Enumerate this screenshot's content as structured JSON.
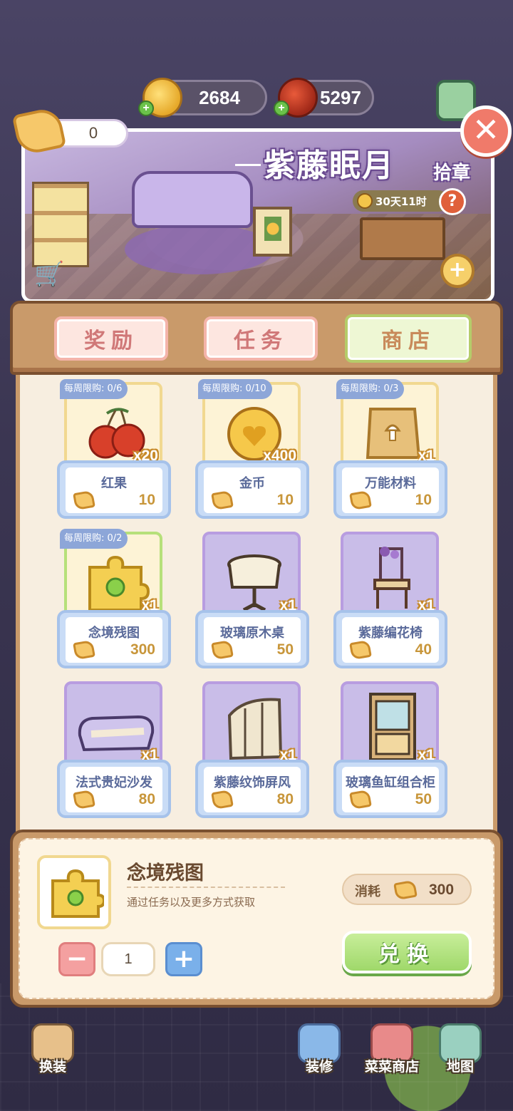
{
  "currencies": {
    "coins": "2684",
    "red_fruit": "5297"
  },
  "star_balance": "0",
  "event": {
    "title": "紫藤眠月",
    "chapter": "拾章",
    "timer": "30天11时",
    "help": "?"
  },
  "tabs": [
    {
      "label": "奖励",
      "active": false
    },
    {
      "label": "任务",
      "active": false
    },
    {
      "label": "商店",
      "active": true
    }
  ],
  "shop_items": [
    {
      "name": "红果",
      "qty": "x20",
      "price": "10",
      "limit": "每周限购: 0/6",
      "art": "cherry-icon"
    },
    {
      "name": "金币",
      "qty": "x400",
      "price": "10",
      "limit": "每周限购: 0/10",
      "art": "gold-coin-icon"
    },
    {
      "name": "万能材料",
      "qty": "x1",
      "price": "10",
      "limit": "每周限购: 0/3",
      "art": "material-bag-icon"
    },
    {
      "name": "念境残图",
      "qty": "x1",
      "price": "300",
      "limit": "每周限购: 0/2",
      "art": "puzzle-piece-icon"
    },
    {
      "name": "玻璃原木桌",
      "qty": "x1",
      "price": "50",
      "limit": "",
      "art": "table-icon"
    },
    {
      "name": "紫藤编花椅",
      "qty": "x1",
      "price": "40",
      "limit": "",
      "art": "chair-icon"
    },
    {
      "name": "法式贵妃沙发",
      "qty": "x1",
      "price": "80",
      "limit": "",
      "art": "sofa-icon"
    },
    {
      "name": "紫藤纹饰屏风",
      "qty": "x1",
      "price": "80",
      "limit": "",
      "art": "screen-icon"
    },
    {
      "name": "玻璃鱼缸组合柜",
      "qty": "x1",
      "price": "50",
      "limit": "",
      "art": "cabinet-icon"
    }
  ],
  "detail": {
    "name": "念境残图",
    "description": "通过任务以及更多方式获取",
    "cost_label": "消耗",
    "cost_value": "300",
    "quantity": "1",
    "minus": "−",
    "plus": "+",
    "exchange_label": "兑换"
  },
  "bottom_nav": [
    {
      "label": "换装"
    },
    {
      "label": "装修"
    },
    {
      "label": "菜菜商店"
    },
    {
      "label": "地图"
    }
  ],
  "colors": {
    "tab_active_bg": "#eef7d4",
    "tab_inactive_text": "#d07878",
    "exchange_button": "#9fd86a",
    "close_button": "#f07a6a"
  }
}
